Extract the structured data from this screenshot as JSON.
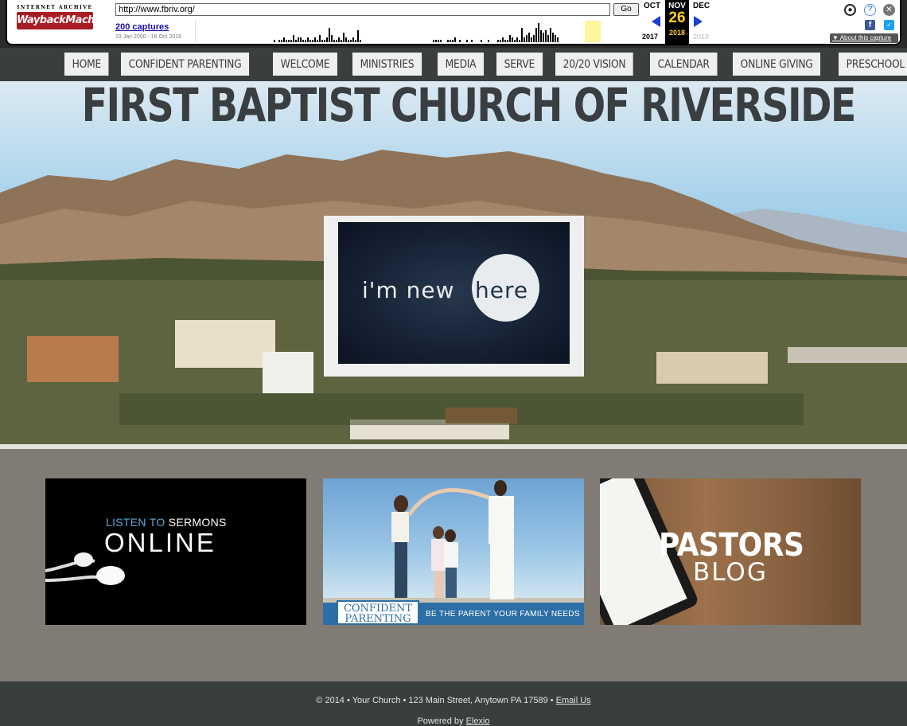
{
  "wayback": {
    "logo_top": "INTERNET ARCHIVE",
    "logo_main": "WaybackMachine",
    "url": "http://www.fbriv.org/",
    "go_label": "Go",
    "captures_link": "200 captures",
    "capture_range": "19 Jan 2000 - 16 Oct 2019",
    "prev_month": "OCT",
    "current_month": "NOV",
    "next_month": "DEC",
    "current_day": "26",
    "prev_year": "2017",
    "current_year": "2018",
    "next_year": "2019",
    "about_label": "About this capture",
    "icons": [
      "user-icon",
      "help-icon",
      "close-icon",
      "facebook-icon",
      "twitter-icon"
    ],
    "sparkline_levels": [
      0,
      0,
      0,
      0,
      0,
      0,
      0,
      0,
      0,
      0,
      0,
      0,
      0,
      0,
      0,
      0,
      0,
      0,
      0,
      0,
      0,
      0,
      0,
      0,
      0,
      0,
      0,
      0,
      0,
      0,
      0,
      0,
      0,
      1,
      0,
      1,
      1,
      2,
      1,
      1,
      1,
      3,
      1,
      2,
      2,
      1,
      1,
      2,
      1,
      1,
      2,
      1,
      3,
      1,
      1,
      2,
      6,
      3,
      1,
      1,
      2,
      1,
      4,
      2,
      1,
      1,
      2,
      1,
      5,
      1,
      0,
      0,
      0,
      0,
      0,
      0,
      0,
      0,
      0,
      0,
      0,
      0,
      0,
      0,
      0,
      0,
      0,
      0,
      0,
      0,
      0,
      0,
      0,
      0,
      0,
      0,
      0,
      0,
      0,
      0,
      1,
      1,
      1,
      1,
      0,
      0,
      1,
      1,
      1,
      2,
      0,
      1,
      0,
      0,
      1,
      0,
      1,
      0,
      0,
      0,
      1,
      0,
      0,
      1,
      0,
      0,
      0,
      1,
      1,
      2,
      1,
      1,
      3,
      2,
      1,
      2,
      1,
      6,
      2,
      3,
      4,
      2,
      3,
      6,
      8,
      5,
      4,
      5,
      3,
      6,
      4,
      3,
      2,
      0,
      0,
      0,
      0,
      0,
      0,
      0,
      0,
      0,
      0,
      0,
      0,
      0,
      0,
      0,
      0,
      0,
      0,
      0,
      0,
      0,
      0,
      0,
      0,
      0,
      0,
      0,
      0,
      0,
      0,
      0,
      0,
      0
    ]
  },
  "nav": {
    "items": [
      {
        "label": "HOME"
      },
      {
        "label": "CONFIDENT PARENTING"
      },
      {
        "label": "WELCOME"
      },
      {
        "label": "MINISTRIES"
      },
      {
        "label": "MEDIA"
      },
      {
        "label": "SERVE"
      },
      {
        "label": "20/20 VISION"
      },
      {
        "label": "CALENDAR"
      },
      {
        "label": "ONLINE GIVING"
      },
      {
        "label": "PRESCHOOL"
      }
    ]
  },
  "hero": {
    "title": "FIRST BAPTIST CHURCH OF RIVERSIDE",
    "new_here_text": "i'm new",
    "new_here_circle_text": "here"
  },
  "cards": {
    "sermons_line1_a": "LISTEN TO ",
    "sermons_line1_b": "SERMONS",
    "sermons_line2": "ONLINE",
    "parenting_logo_1": "CONFIDENT",
    "parenting_logo_2": "PARENTING",
    "parenting_tagline": "BE THE PARENT YOUR FAMILY NEEDS",
    "blog_line1": "PASTORS",
    "blog_line2": "BLOG"
  },
  "footer": {
    "line1": "© 2014 • Your Church • 123 Main Street, Anytown PA 17589 • ",
    "email_link": "Email Us",
    "powered_prefix": "Powered by ",
    "powered_link": "Elexio"
  },
  "colors": {
    "nav_bg": "#3a3e3f",
    "body_bg": "#807c75",
    "title_color": "#3a3e40",
    "wayback_red": "#a91c24",
    "wayback_yellow": "#ffd21a"
  }
}
